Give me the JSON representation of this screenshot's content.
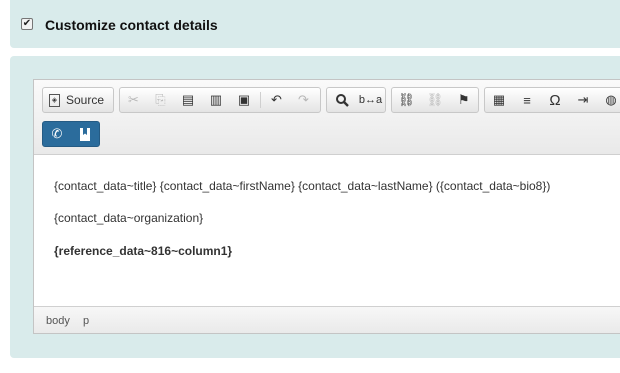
{
  "header": {
    "checkbox_checked": true,
    "checkbox_label": "Customize contact details"
  },
  "editor": {
    "toolbar": {
      "source_label": "Source",
      "icons": {
        "cut": "✂",
        "copy": "⎘",
        "paste": "📋",
        "undo": "↶",
        "redo": "↷",
        "find": "🔍",
        "replace": "b↔a",
        "link": "⛓",
        "unlink": "⛓",
        "anchor": "⚑",
        "table": "▦",
        "hr": "≡",
        "special_char": "Ω",
        "indent": "⇥",
        "globe": "🌐",
        "phone": "✆",
        "bookmark": "🔖"
      }
    },
    "content": {
      "line1": "{contact_data~title} {contact_data~firstName} {contact_data~lastName} ({contact_data~bio8})",
      "line2": "{contact_data~organization}",
      "line3": "{reference_data~816~column1}"
    },
    "status_path": [
      "body",
      "p"
    ]
  }
}
